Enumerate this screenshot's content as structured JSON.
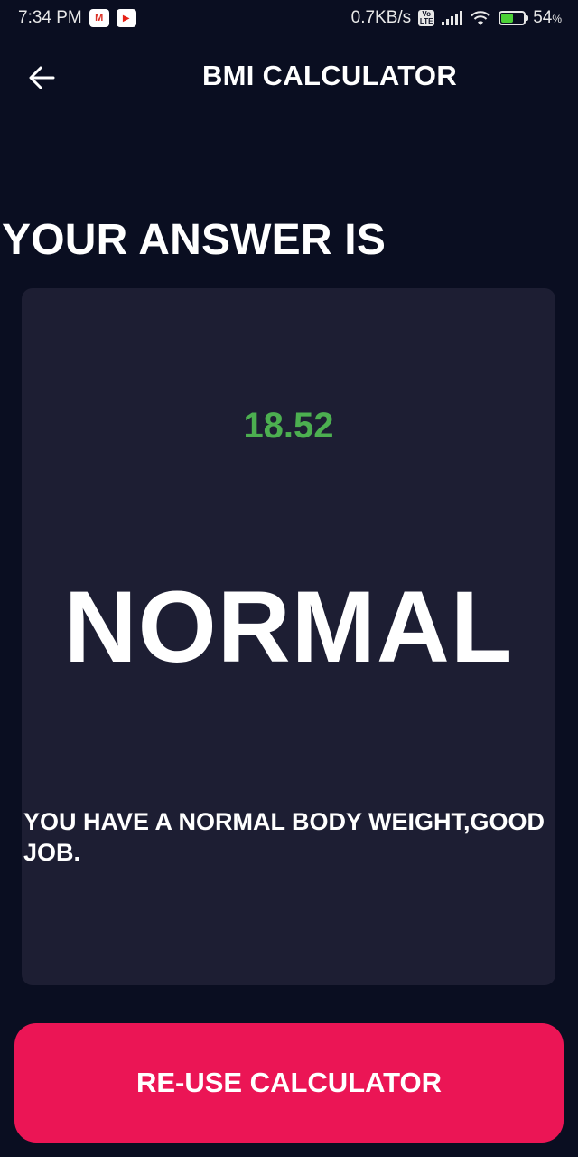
{
  "status_bar": {
    "time": "7:34 PM",
    "network_speed": "0.7KB/s",
    "volte_label": "Vo LTE",
    "battery_percent": "54",
    "battery_unit": "%",
    "battery_level": 0.54,
    "icons": [
      "gmail-icon",
      "youtube-icon",
      "volte-icon",
      "signal-icon",
      "wifi-icon",
      "battery-charging-icon"
    ]
  },
  "app_bar": {
    "title": "BMI CALCULATOR",
    "back_icon": "arrow-left-icon"
  },
  "main": {
    "heading": "YOUR ANSWER IS",
    "result": {
      "bmi_value": "18.52",
      "status": "NORMAL",
      "message": "YOU HAVE A NORMAL BODY WEIGHT,GOOD JOB."
    },
    "reuse_button_label": "RE-USE CALCULATOR"
  },
  "colors": {
    "background": "#0a0e21",
    "card": "#1d1e33",
    "bmi_value": "#4caf50",
    "accent_button": "#eb1555",
    "text": "#ffffff"
  }
}
